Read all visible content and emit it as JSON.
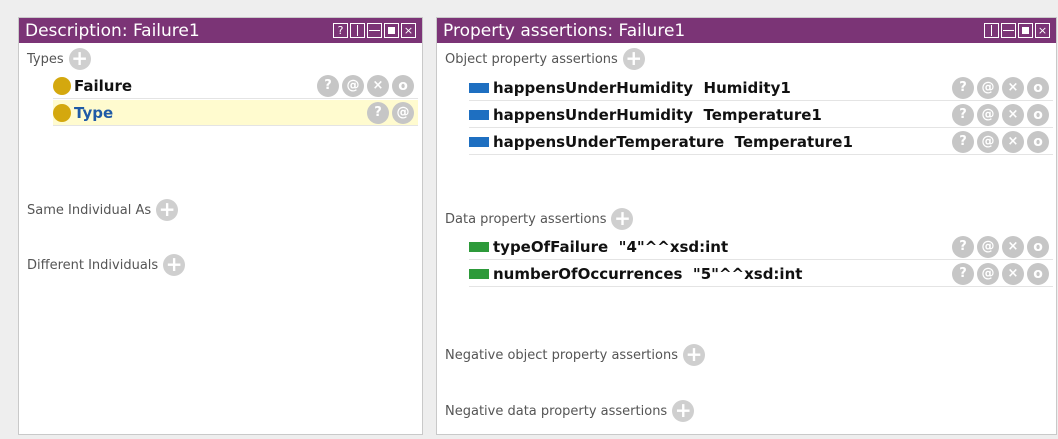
{
  "left_panel": {
    "title": "Description: Failure1",
    "header_buttons": [
      "?",
      "□",
      "≡",
      "■",
      "×"
    ],
    "types_label": "Types",
    "types": [
      {
        "label": "Failure",
        "actions": [
          "?",
          "@",
          "×",
          "o"
        ]
      },
      {
        "label": "Type",
        "actions": [
          "?",
          "@"
        ]
      }
    ],
    "same_individual_label": "Same Individual As",
    "different_individuals_label": "Different Individuals"
  },
  "right_panel": {
    "title": "Property assertions: Failure1",
    "object_assertions_label": "Object property assertions",
    "object_assertions": [
      {
        "property": "happensUnderHumidity",
        "value": "Humidity1"
      },
      {
        "property": "happensUnderHumidity",
        "value": "Temperature1"
      },
      {
        "property": "happensUnderTemperature",
        "value": "Temperature1"
      }
    ],
    "data_assertions_label": "Data property assertions",
    "data_assertions": [
      {
        "property": "typeOfFailure",
        "value": "\"4\"^^xsd:int"
      },
      {
        "property": "numberOfOccurrences",
        "value": "\"5\"^^xsd:int"
      }
    ],
    "negative_object_label": "Negative object property assertions",
    "negative_data_label": "Negative data property assertions"
  },
  "action_labels": {
    "help": "?",
    "annotate": "@",
    "delete": "×",
    "edit": "o"
  },
  "add_label": "+",
  "colors": {
    "header": "#7b3476",
    "object_property": "#1e6fc1",
    "data_property": "#2d9a3a",
    "individual_type": "#d4a80e",
    "highlight": "#fffbcf"
  }
}
